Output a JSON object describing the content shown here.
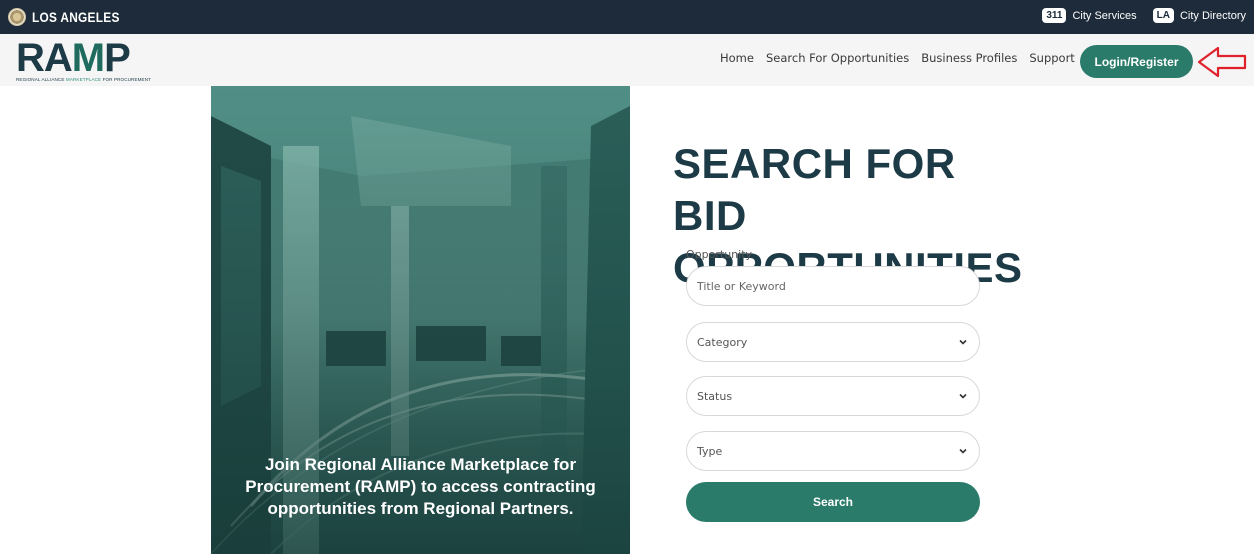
{
  "citybar": {
    "name": "LOS ANGELES",
    "badge_311": "311",
    "city_services": "City Services",
    "badge_la": "LA",
    "city_directory": "City Directory"
  },
  "logo": {
    "word_start": "RA",
    "word_m": "M",
    "word_end": "P",
    "tagline_a": "REGIONAL ALLIANCE ",
    "tagline_b": "MARKETPLACE",
    "tagline_c": " FOR PROCUREMENT"
  },
  "nav": {
    "items": [
      "Home",
      "Search For Opportunities",
      "Business Profiles",
      "Support"
    ],
    "login_label": "Login/Register"
  },
  "hero": {
    "caption": "Join Regional Alliance Marketplace for Procurement (RAMP) to access contracting opportunities from Regional Partners."
  },
  "search": {
    "title_line1": "SEARCH FOR BID",
    "title_line2": "OPPORTUNITIES",
    "opportunity_label": "Opportunity",
    "keyword_placeholder": "Title or Keyword",
    "category": "Category",
    "status": "Status",
    "type": "Type",
    "button_label": "Search"
  },
  "colors": {
    "brand_green": "#2a7b6a",
    "navy": "#1d3a47",
    "citybar": "#1d2b3a",
    "annotation_arrow": "#e0202a"
  }
}
